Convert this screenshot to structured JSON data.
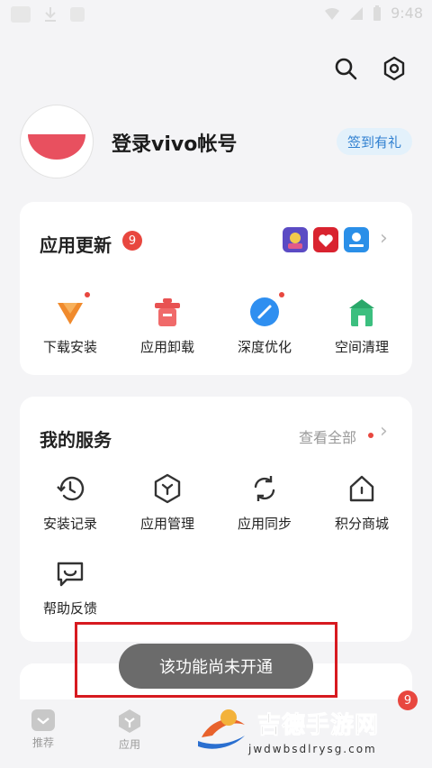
{
  "statusbar": {
    "time": "9:48"
  },
  "profile": {
    "login_text": "登录vivo帐号",
    "checkin_label": "签到有礼"
  },
  "updates": {
    "title": "应用更新",
    "badge_count": "9",
    "items": [
      {
        "label": "下载安装",
        "icon": "download-install-icon",
        "color": "#f08a2c"
      },
      {
        "label": "应用卸载",
        "icon": "uninstall-trash-icon",
        "color": "#e85252"
      },
      {
        "label": "深度优化",
        "icon": "optimize-gauge-icon",
        "color": "#2f8ff0"
      },
      {
        "label": "空间清理",
        "icon": "space-clean-icon",
        "color": "#2aa86a"
      }
    ]
  },
  "services": {
    "title": "我的服务",
    "view_all": "查看全部",
    "items": [
      {
        "label": "安装记录",
        "icon": "install-history-icon"
      },
      {
        "label": "应用管理",
        "icon": "app-manage-icon"
      },
      {
        "label": "应用同步",
        "icon": "app-sync-icon"
      },
      {
        "label": "积分商城",
        "icon": "points-mall-icon"
      },
      {
        "label": "帮助反馈",
        "icon": "help-feedback-icon"
      }
    ]
  },
  "toast": {
    "message": "该功能尚未开通"
  },
  "bottom_nav": {
    "items": [
      {
        "label": "推荐",
        "icon": "recommend-icon"
      },
      {
        "label": "应用",
        "icon": "apps-icon"
      }
    ],
    "badge_count": "9"
  },
  "watermark": {
    "text": "吉德手游网",
    "url": "jwdwbsdlrysg.com"
  },
  "colors": {
    "accent_blue": "#2f7fd0",
    "badge_red": "#e8473f",
    "highlight_red": "#d71a20"
  }
}
